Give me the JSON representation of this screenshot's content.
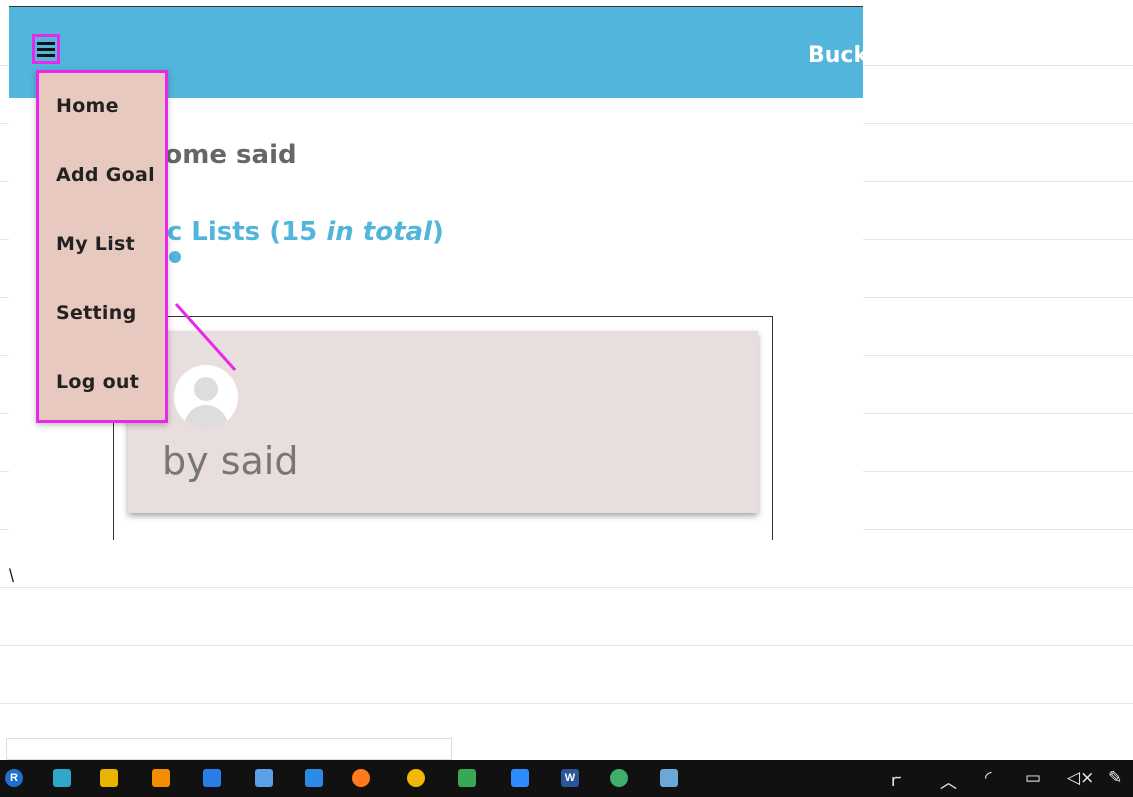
{
  "app": {
    "title": "Buck",
    "welcome": "come said",
    "public_lists_prefix": "lic Lists (15 ",
    "public_lists_italic": "in total",
    "public_lists_suffix": ")",
    "card_by": "by said"
  },
  "menu": {
    "items": [
      {
        "label": "Home"
      },
      {
        "label": "Add Goal"
      },
      {
        "label": "My List"
      },
      {
        "label": "Setting"
      },
      {
        "label": "Log out"
      }
    ]
  },
  "notes": {
    "backslash": "\\"
  },
  "taskbar": {
    "apps": [
      {
        "name": "r-icon",
        "color": "#1f6fd0",
        "glyph": "R"
      },
      {
        "name": "git-icon",
        "color": "#2ea7c8",
        "glyph": ""
      },
      {
        "name": "lamp-icon",
        "color": "#e8b400",
        "glyph": ""
      },
      {
        "name": "vlc-icon",
        "color": "#f28c00",
        "glyph": ""
      },
      {
        "name": "camera-app-icon",
        "color": "#2b7de9",
        "glyph": ""
      },
      {
        "name": "network-tool-icon",
        "color": "#5aa0e6",
        "glyph": ""
      },
      {
        "name": "vscode-icon",
        "color": "#2a8ae6",
        "glyph": ""
      },
      {
        "name": "firefox-icon",
        "color": "#ff7a1a",
        "glyph": ""
      },
      {
        "name": "chrome-icon",
        "color": "#f2b705",
        "glyph": ""
      },
      {
        "name": "store-icon",
        "color": "#3aa757",
        "glyph": ""
      },
      {
        "name": "zoom-icon",
        "color": "#2d8cff",
        "glyph": ""
      },
      {
        "name": "word-icon",
        "color": "#2b579a",
        "glyph": "W"
      },
      {
        "name": "atom-icon",
        "color": "#3fae6a",
        "glyph": ""
      },
      {
        "name": "notes-app-icon",
        "color": "#6aa8d8",
        "glyph": ""
      }
    ],
    "tray": [
      {
        "name": "people-icon",
        "glyph": "ꭈ"
      },
      {
        "name": "chevron-up-icon",
        "glyph": "︿"
      },
      {
        "name": "wifi-icon",
        "glyph": "◜"
      },
      {
        "name": "battery-icon",
        "glyph": "▭"
      },
      {
        "name": "volume-muted-icon",
        "glyph": "◁×"
      },
      {
        "name": "pen-icon",
        "glyph": "✎"
      }
    ]
  }
}
